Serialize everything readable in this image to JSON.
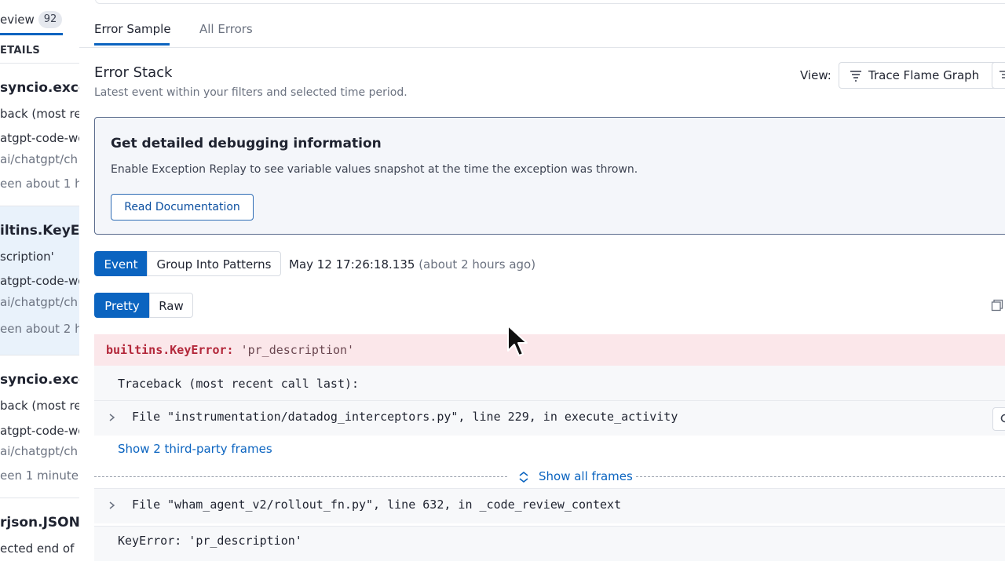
{
  "left_panel": {
    "review_tab_label": "eview",
    "review_count": "92",
    "details_header": "ETAILS",
    "items": [
      {
        "title": "syncio.excep",
        "line1": "back (most rec",
        "line2": "atgpt-code-wo",
        "line3": "ai/chatgpt/ch",
        "line4": "een about 1 h"
      },
      {
        "title": "iltins.KeyEr",
        "line1": "scription'",
        "line2": "atgpt-code-wo",
        "line3": "ai/chatgpt/ch",
        "line4": "een about 2 h"
      },
      {
        "title": "syncio.excep",
        "line1": "back (most rec",
        "line2": "atgpt-code-wo",
        "line3": "ai/chatgpt/ch",
        "line4": "een 1 minute"
      },
      {
        "title": "rjson.JSOND",
        "line1": "ected end of"
      }
    ]
  },
  "tabs": {
    "error_sample": "Error Sample",
    "all_errors": "All Errors"
  },
  "error_stack": {
    "title": "Error Stack",
    "subtitle": "Latest event within your filters and selected time period.",
    "view_label": "View:",
    "view_button": "Trace Flame Graph"
  },
  "callout": {
    "title": "Get detailed debugging information",
    "description": "Enable Exception Replay to see variable values snapshot at the time the exception was thrown.",
    "button": "Read Documentation"
  },
  "event_controls": {
    "event": "Event",
    "group_into_patterns": "Group Into Patterns",
    "timestamp": "May 12 17:26:18.135",
    "relative": "(about 2 hours ago)",
    "pretty": "Pretty",
    "raw": "Raw"
  },
  "trace": {
    "error_type": "builtins.KeyError:",
    "error_message": "'pr_description'",
    "traceback_header": "Traceback (most recent call last):",
    "frame1": "File \"instrumentation/datadog_interceptors.py\", line 229, in execute_activity",
    "third_party_link": "Show 2 third-party frames",
    "show_all_frames": "Show all frames",
    "frame2": "File \"wham_agent_v2/rollout_fn.py\", line 632, in _code_review_context",
    "final_error": "KeyError: 'pr_description'"
  },
  "colors": {
    "accent": "#0b64c0",
    "error_bg": "#fbe7ea",
    "error_text": "#b3273a"
  }
}
